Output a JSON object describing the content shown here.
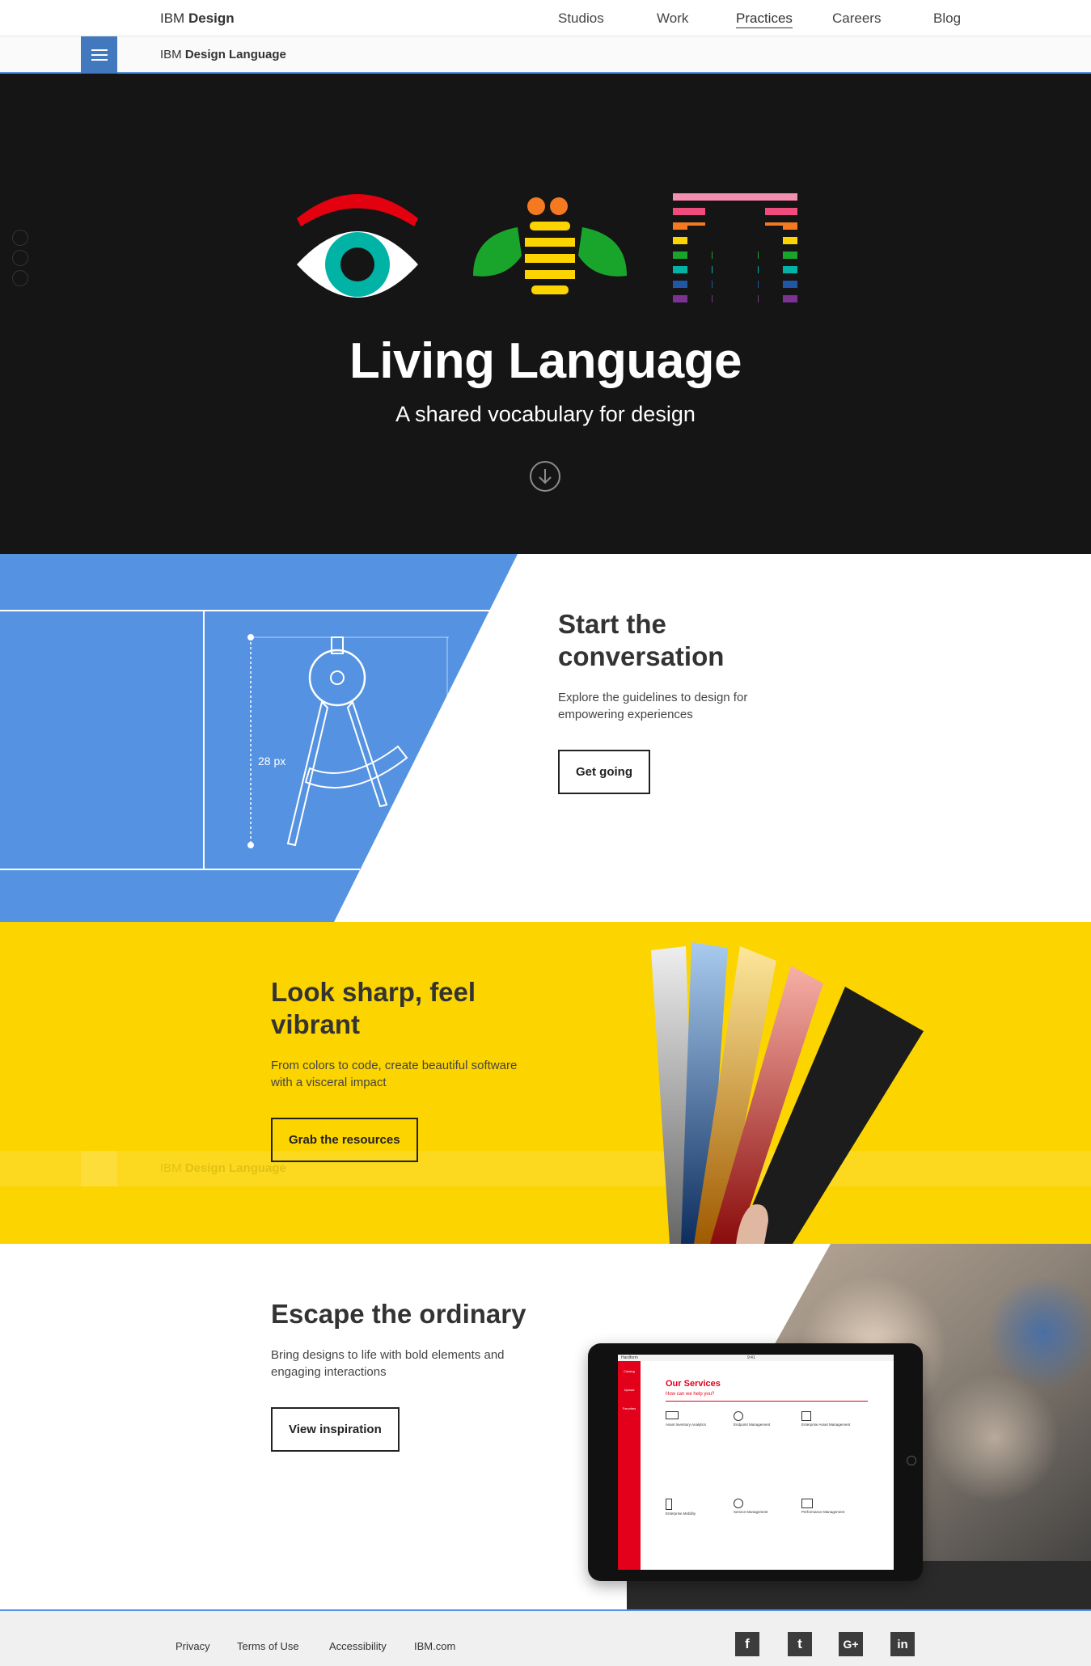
{
  "topnav": {
    "brand_prefix": "IBM",
    "brand_name": "Design",
    "links": [
      {
        "label": "Studios"
      },
      {
        "label": "Work"
      },
      {
        "label": "Practices",
        "active": true
      },
      {
        "label": "Careers"
      },
      {
        "label": "Blog"
      }
    ]
  },
  "subnav": {
    "title_prefix": "IBM",
    "title_name": "Design Language"
  },
  "hero": {
    "title": "Living Language",
    "subtitle": "A shared vocabulary for design",
    "icons": [
      "eye-icon",
      "bee-icon",
      "m-logo-icon"
    ]
  },
  "section1": {
    "title": "Start the conversation",
    "body": "Explore the guidelines to design for empowering experiences",
    "button": "Get going",
    "art_label": "28 px",
    "accent": "#5593e2"
  },
  "section2": {
    "title": "Look sharp, feel vibrant",
    "body": "From colors to code, create beautiful software with a visceral impact",
    "button": "Grab the resources",
    "ghost_title_prefix": "IBM",
    "ghost_title_name": "Design Language",
    "accent": "#fcd400"
  },
  "section3": {
    "title": "Escape the ordinary",
    "body": "Bring designs to life with bold elements and engaging interactions",
    "button": "View inspiration",
    "tablet": {
      "heading": "Our Services",
      "search_placeholder": "How can we help you?",
      "status_left": "Hardform",
      "status_time": "9:41",
      "sidebar": [
        "Catalog",
        "Upload",
        "Favorites"
      ],
      "services": [
        "Asset Inventory Analytics",
        "Endpoint Management",
        "Enterprise Asset Management",
        "Enterprise Mobility",
        "Service Management",
        "Performance Management"
      ]
    }
  },
  "footer": {
    "links": [
      "Privacy",
      "Terms of Use",
      "Accessibility",
      "IBM.com"
    ],
    "social": [
      {
        "name": "facebook",
        "glyph": "f"
      },
      {
        "name": "twitter",
        "glyph": "t"
      },
      {
        "name": "google-plus",
        "glyph": "G+"
      },
      {
        "name": "linkedin",
        "glyph": "in"
      }
    ]
  }
}
